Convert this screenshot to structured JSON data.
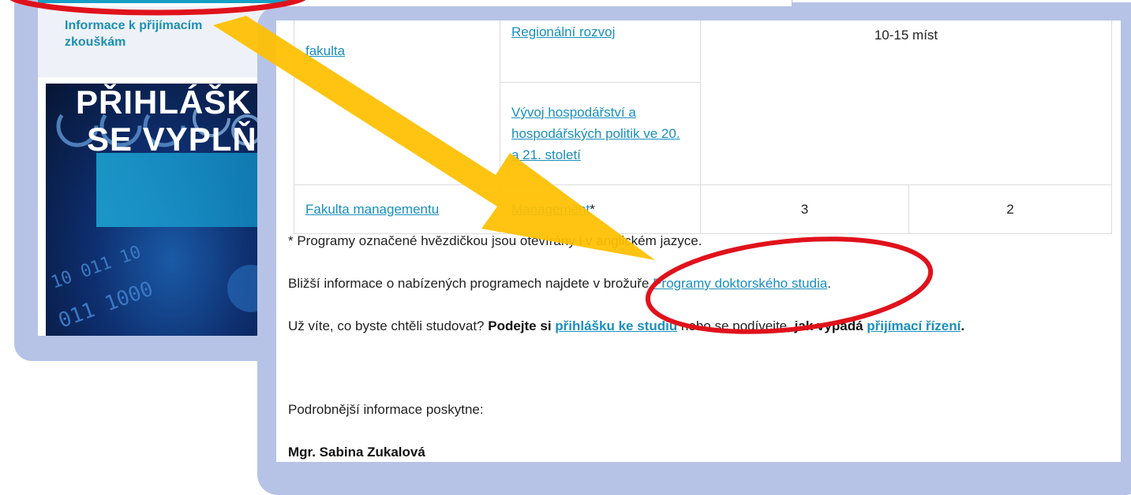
{
  "sidebar": {
    "link_label": "Informace k přijímacím zkouškám"
  },
  "promo": {
    "line1": "PŘIHLÁŠK",
    "line2": "SE VYPLŇ"
  },
  "table": {
    "rows": [
      {
        "faculty": "fakulta",
        "program": "Regionální rozvoj",
        "places": "10-15 míst"
      },
      {
        "faculty": "",
        "program": "Vývoj hospodářství a hospodářských politik ve 20. a 21. století",
        "places": ""
      },
      {
        "faculty": "Fakulta managementu",
        "program": "Management",
        "program_mark": "*",
        "col3": "3",
        "col4": "2"
      }
    ]
  },
  "content": {
    "note": "* Programy označené hvězdičkou jsou otevírány i v anglickém jazyce.",
    "brochure_prefix": "Bližší informace o nabízených programech najdete v brožuře ",
    "brochure_link": "Programy doktorského studia",
    "brochure_suffix": ".",
    "cta_prefix": "Už víte, co byste chtěli studovat? ",
    "cta_bold": "Podejte si ",
    "cta_link1": "přihlášku ke studiu",
    "cta_mid": " nebo se podívejte",
    "cta_bold2": ", jak vypadá ",
    "cta_link2": "přijímací řízení",
    "cta_end": ".",
    "contact_intro": "Podrobnější informace poskytne:",
    "contact_name": "Mgr. Sabina Zukalová"
  },
  "colors": {
    "accent": "#1a8fbd",
    "frame": "#b7c3e6",
    "arrow": "#ffbf00",
    "highlight": "#e0121b"
  }
}
